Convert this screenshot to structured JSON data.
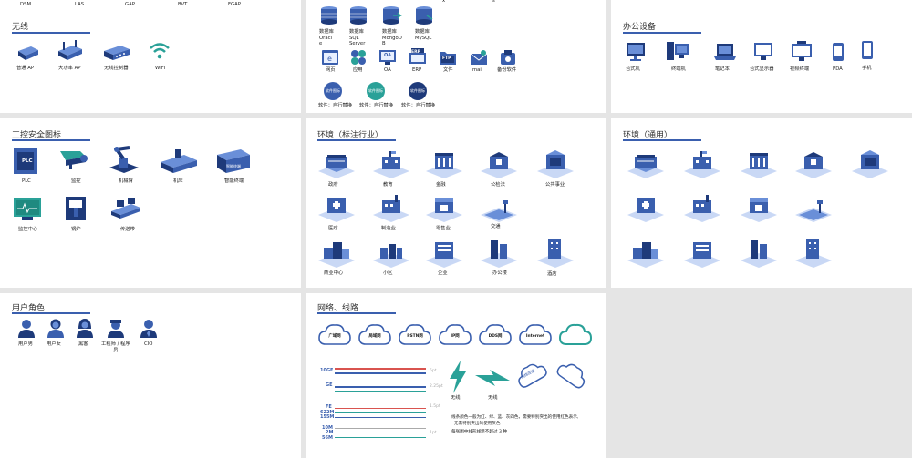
{
  "top_row_labels": [
    "DSM",
    "LAS",
    "GAP",
    "BVT",
    "FGAP"
  ],
  "wireless": {
    "title": "无线",
    "items": [
      "普通 AP",
      "大功率 AP",
      "无线控制器",
      "WIFI"
    ]
  },
  "database": {
    "db_items": [
      "数据库\nOracl\ne",
      "数据库\nSQL\nServer",
      "数据库\nMongoD\nB",
      "数据库\nMySQL"
    ],
    "apps": [
      "网页",
      "应用",
      "OA",
      "ERP",
      "文件",
      "mail",
      "备份软件"
    ],
    "app_badges": {
      "oa": "OA",
      "erp": "ERP",
      "ftp": "FTP"
    },
    "software": [
      "软件：自行替换",
      "软件：自行替换",
      "软件：自行替换"
    ],
    "software_badge": "软件图标"
  },
  "office": {
    "title": "办公设备",
    "items": [
      "台式机",
      "终端机",
      "笔记本",
      "台式显示器",
      "视频终端",
      "PDA",
      "手机"
    ]
  },
  "ics": {
    "title": "工控安全图标",
    "items": [
      "PLC",
      "监控",
      "机械臂",
      "机床",
      "智能终端",
      "监控中心",
      "锅炉",
      "传送带"
    ],
    "plc_badge": "PLC",
    "smart_badge": "智能终端"
  },
  "env_ind": {
    "title": "环境（标注行业）",
    "items": [
      "政府",
      "教育",
      "金融",
      "公检法",
      "公共事业",
      "医疗",
      "制造业",
      "零售业",
      "交通",
      "商业中心",
      "小区",
      "企业",
      "办公楼",
      "酒店"
    ]
  },
  "env_gen": {
    "title": "环境（通用）"
  },
  "users": {
    "title": "用户角色",
    "items": [
      "用户男",
      "用户女",
      "黑客",
      "工程师 / 程序\n员",
      "CIO"
    ]
  },
  "network": {
    "title": "网络、线路",
    "clouds": [
      "广域网",
      "局域网",
      "PSTN网",
      "IP网",
      "DDS网",
      "Internet"
    ],
    "line_labels": [
      "10GE",
      "GE",
      "FE",
      "622M",
      "155M",
      "10M",
      "2M",
      "56M"
    ],
    "line_notes": [
      "5pt",
      "2.25pt",
      "1.5pt",
      "1pt"
    ],
    "wireless_labels": [
      "无线",
      "无线"
    ],
    "cloud_tag": "网络连接",
    "notes": [
      "线条颜色一般为红、绿、蓝、灰四色，需要特别突出的使用红色表示,\n  无需特别突出的使用灰色",
      "每张图中线形线粗不超过 3 种"
    ]
  },
  "colors": {
    "accent": "#3a5fae",
    "dark": "#1e3a7a",
    "light": "#6a8fd8",
    "teal": "#2aa198",
    "red": "#d9534f"
  }
}
